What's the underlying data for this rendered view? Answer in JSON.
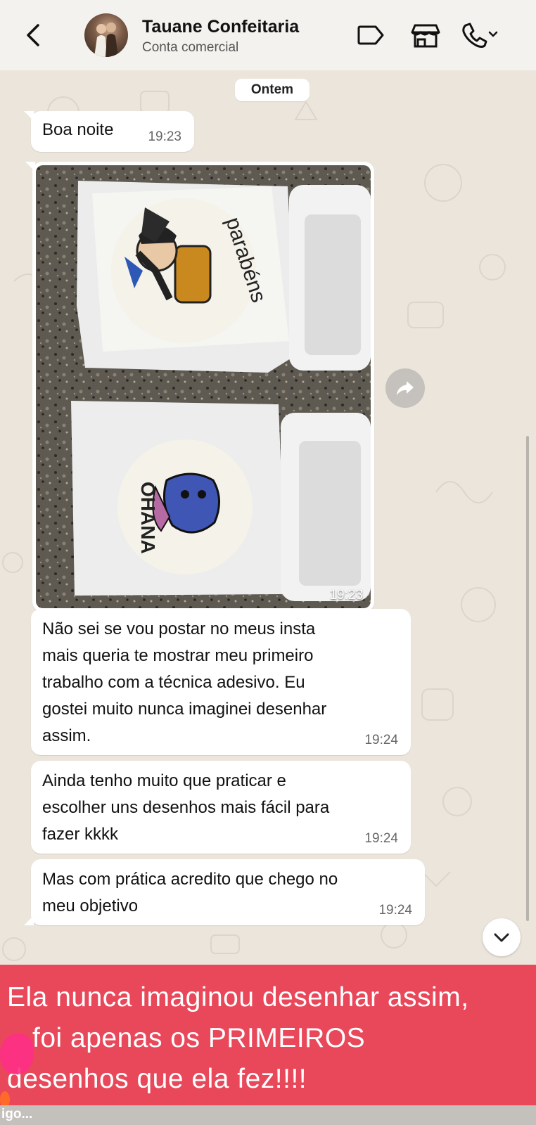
{
  "header": {
    "contact_name": "Tauane Confeitaria",
    "contact_subtitle": "Conta comercial",
    "icons": [
      "back-arrow-icon",
      "label-tag-icon",
      "storefront-icon",
      "phone-call-icon",
      "chevron-down-icon"
    ]
  },
  "chat": {
    "date_separator": "Ontem",
    "messages": [
      {
        "text": "Boa noite",
        "time": "19:23"
      },
      {
        "type": "image",
        "time": "19:23",
        "cake_texts": [
          "parabéns",
          "OHANA"
        ]
      },
      {
        "text": [
          "Não sei se vou postar no meus insta",
          "mais queria te mostrar meu primeiro",
          "trabalho com a técnica adesivo. Eu",
          "gostei muito nunca imaginei desenhar",
          "assim."
        ],
        "time": "19:24"
      },
      {
        "text": [
          "Ainda tenho muito que praticar e",
          "escolher uns desenhos mais fácil para",
          "fazer kkkk"
        ],
        "time": "19:24"
      },
      {
        "text": [
          "Mas com prática acredito que chego no",
          "meu objetivo"
        ],
        "time": "19:24"
      }
    ],
    "forward_icon": "forward-share-icon",
    "scroll_down_icon": "chevron-down-icon"
  },
  "caption": {
    "lines": [
      "Ela nunca imaginou desenhar assim,",
      "foi apenas os PRIMEIROS",
      "desenhos que ela fez!!!!"
    ],
    "background_color": "#e8485a"
  },
  "bottom_strip_text": "igo..."
}
